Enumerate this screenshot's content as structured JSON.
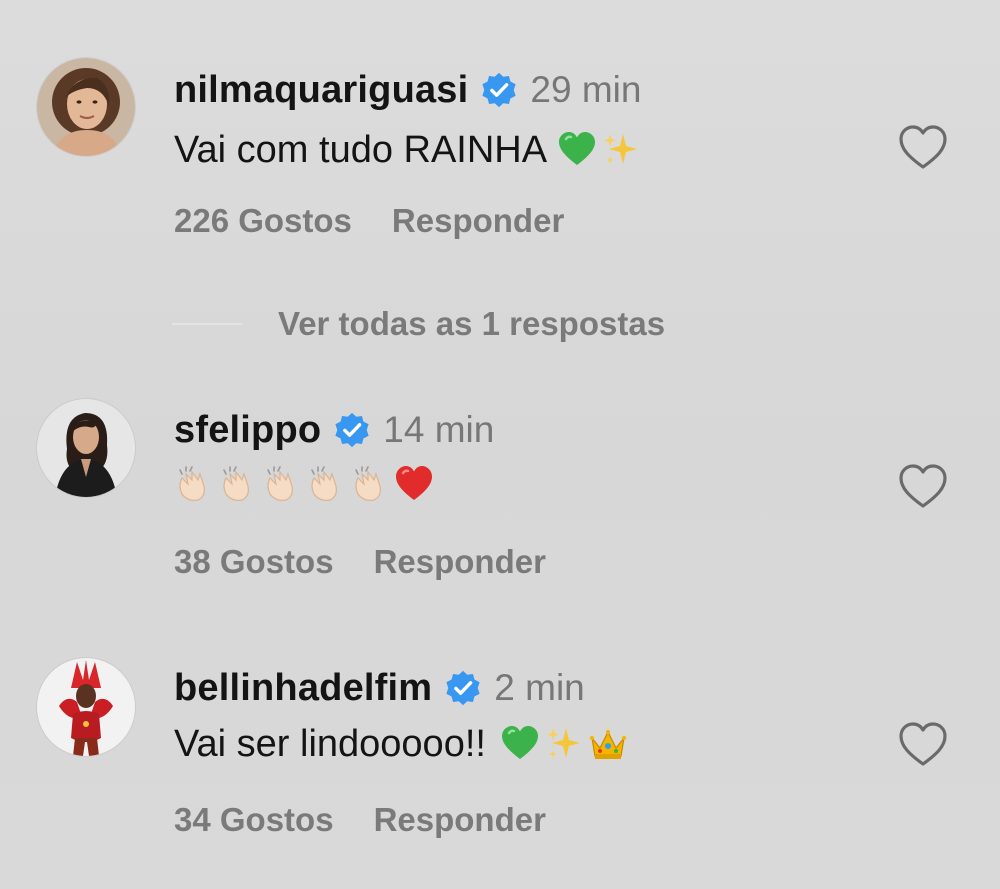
{
  "colors": {
    "background": "#d9d9d9",
    "username": "#141414",
    "secondary_text": "#7a7a7a",
    "verified_badge": "#3897f0",
    "heart_outline": "#6a6a6a"
  },
  "comments": [
    {
      "username": "nilmaquariguasi",
      "verified": true,
      "time": "29 min",
      "text": "Vai com tudo RAINHA",
      "emojis": [
        "green-heart-emoji",
        "sparkles-emoji"
      ],
      "likes": "226 Gostos",
      "reply_label": "Responder",
      "avatar_icon": "woman-portrait-avatar"
    },
    {
      "username": "sfelippo",
      "verified": true,
      "time": "14 min",
      "text": "",
      "emojis": [
        "clapping-hands-emoji",
        "clapping-hands-emoji",
        "clapping-hands-emoji",
        "clapping-hands-emoji",
        "clapping-hands-emoji",
        "red-heart-emoji"
      ],
      "likes": "38 Gostos",
      "reply_label": "Responder",
      "avatar_icon": "woman-dark-hair-avatar"
    },
    {
      "username": "bellinhadelfim",
      "verified": true,
      "time": "2 min",
      "text": "Vai ser lindooooo!!",
      "emojis": [
        "green-heart-emoji",
        "sparkles-emoji",
        "crown-emoji"
      ],
      "likes": "34 Gostos",
      "reply_label": "Responder",
      "avatar_icon": "carnival-costume-avatar"
    }
  ],
  "view_replies_label": "Ver todas as 1 respostas"
}
